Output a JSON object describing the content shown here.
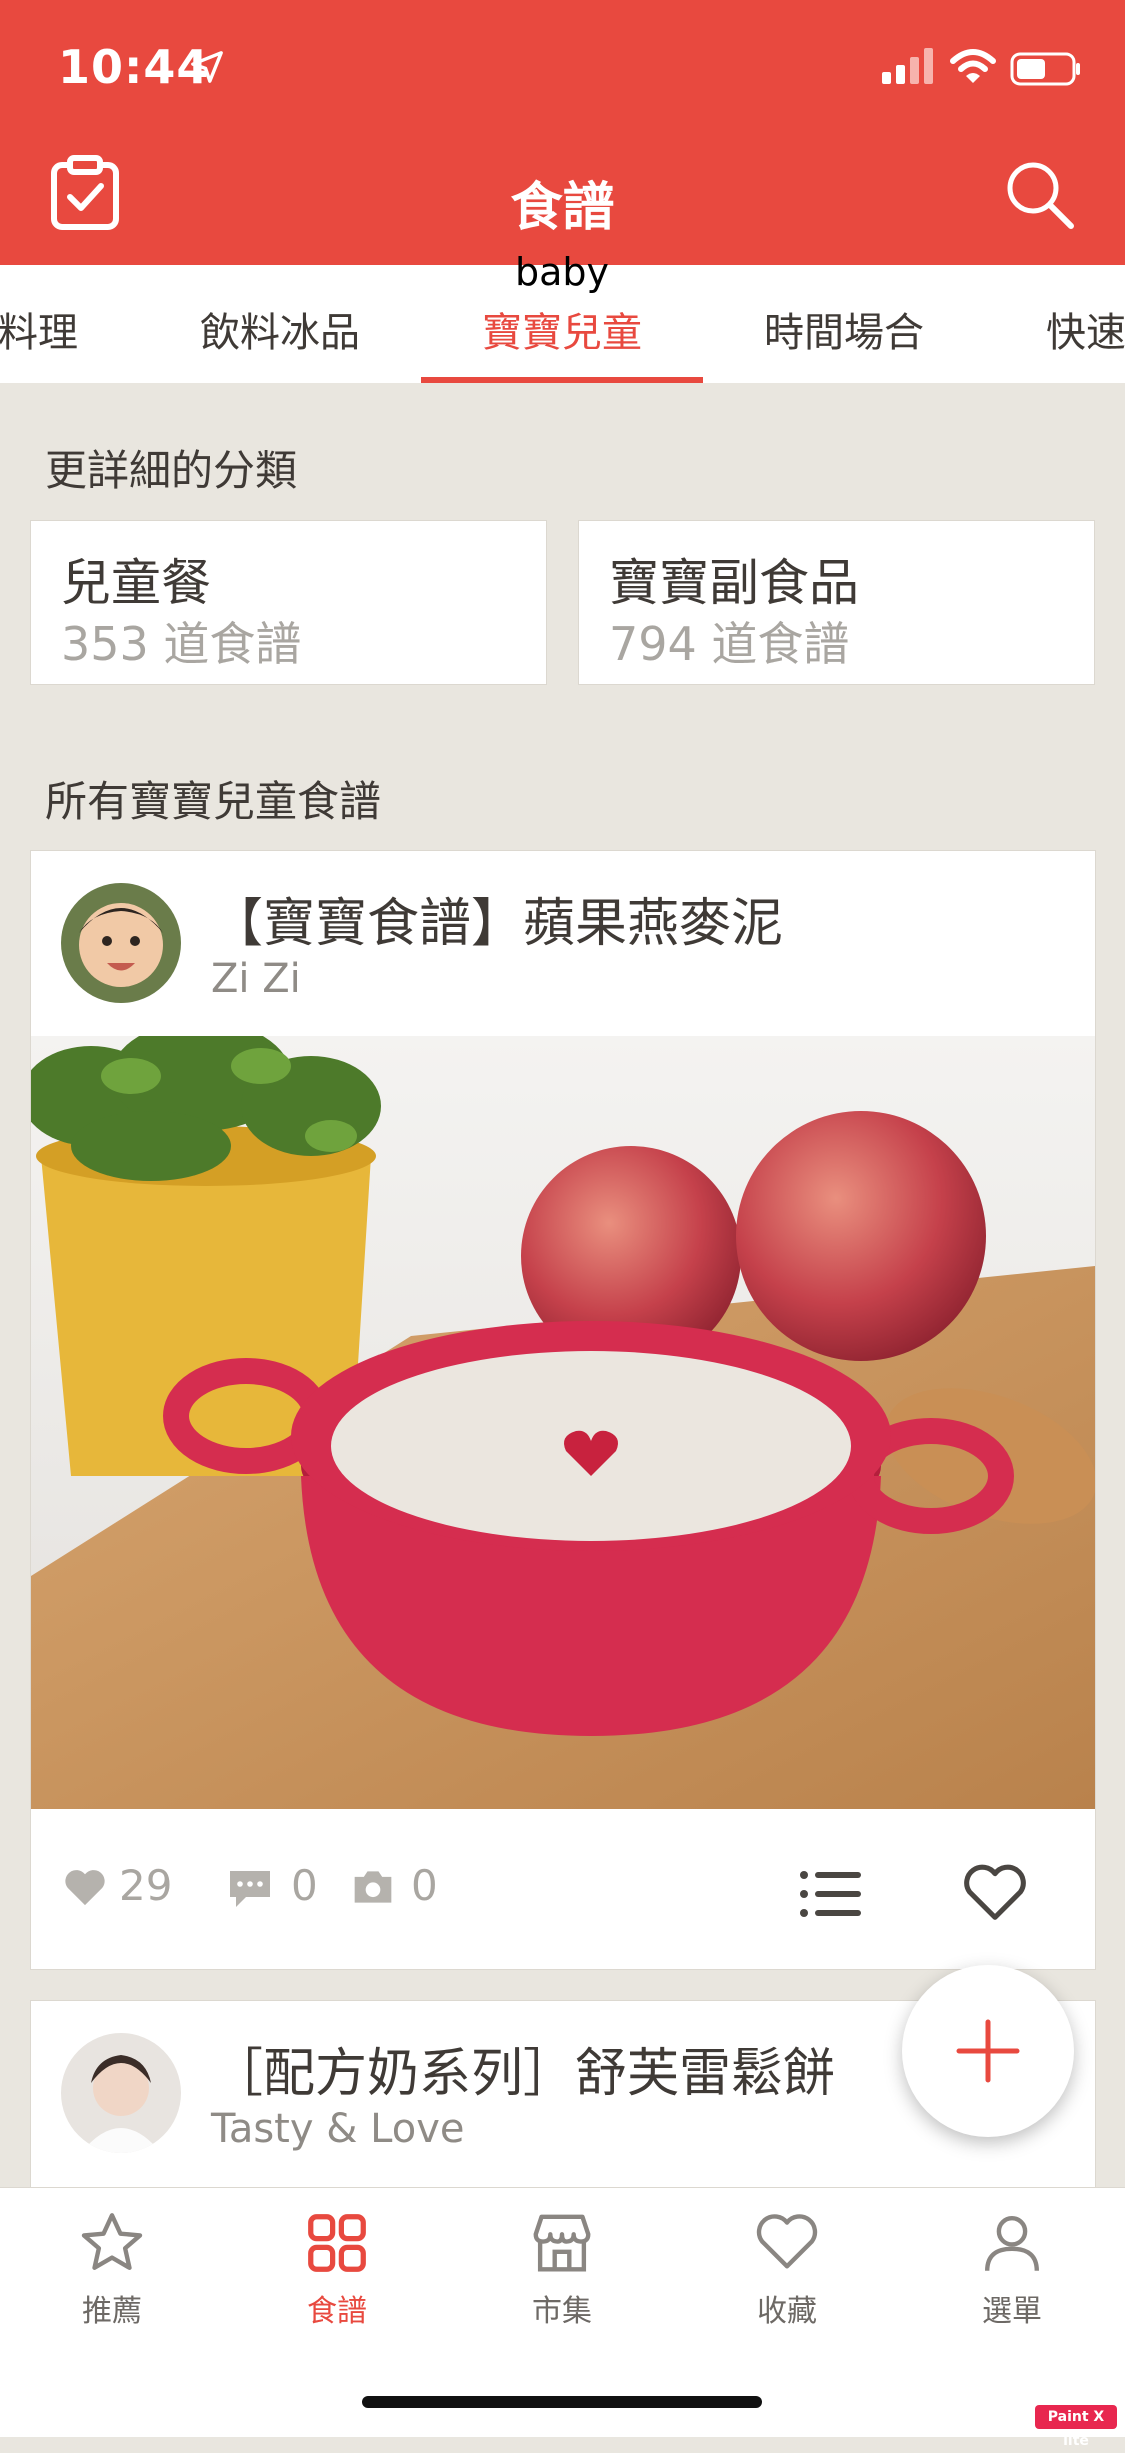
{
  "status_bar": {
    "time": "10:44"
  },
  "header": {
    "title": "食譜"
  },
  "tabs": {
    "items": [
      "料理",
      "飲料冰品",
      "寶寶兒童",
      "時間場合",
      "快速"
    ],
    "active_index": 2,
    "active_overlay_text": "baby"
  },
  "subcategories": {
    "heading": "更詳細的分類",
    "items": [
      {
        "name": "兒童餐",
        "count": "353 道食譜"
      },
      {
        "name": "寶寶副食品",
        "count": "794 道食譜"
      }
    ]
  },
  "all_recipes": {
    "heading": "所有寶寶兒童食譜"
  },
  "recipes": [
    {
      "title": "【寶寶食譜】蘋果燕麥泥",
      "author": "Zi Zi",
      "likes": "29",
      "comments": "0",
      "photos": "0"
    },
    {
      "title": "［配方奶系列］舒芙雷鬆餅",
      "author": "Tasty & Love"
    }
  ],
  "bottom_nav": {
    "items": [
      {
        "label": "推薦",
        "icon": "star-icon"
      },
      {
        "label": "食譜",
        "icon": "grid-icon"
      },
      {
        "label": "市集",
        "icon": "store-icon"
      },
      {
        "label": "收藏",
        "icon": "heart-icon"
      },
      {
        "label": "選單",
        "icon": "person-icon"
      }
    ],
    "active_index": 1
  },
  "watermark": "Paint X lite",
  "colors": {
    "brand_red": "#e8493f",
    "background": "#e9e6df",
    "muted": "#a9a6a1"
  }
}
